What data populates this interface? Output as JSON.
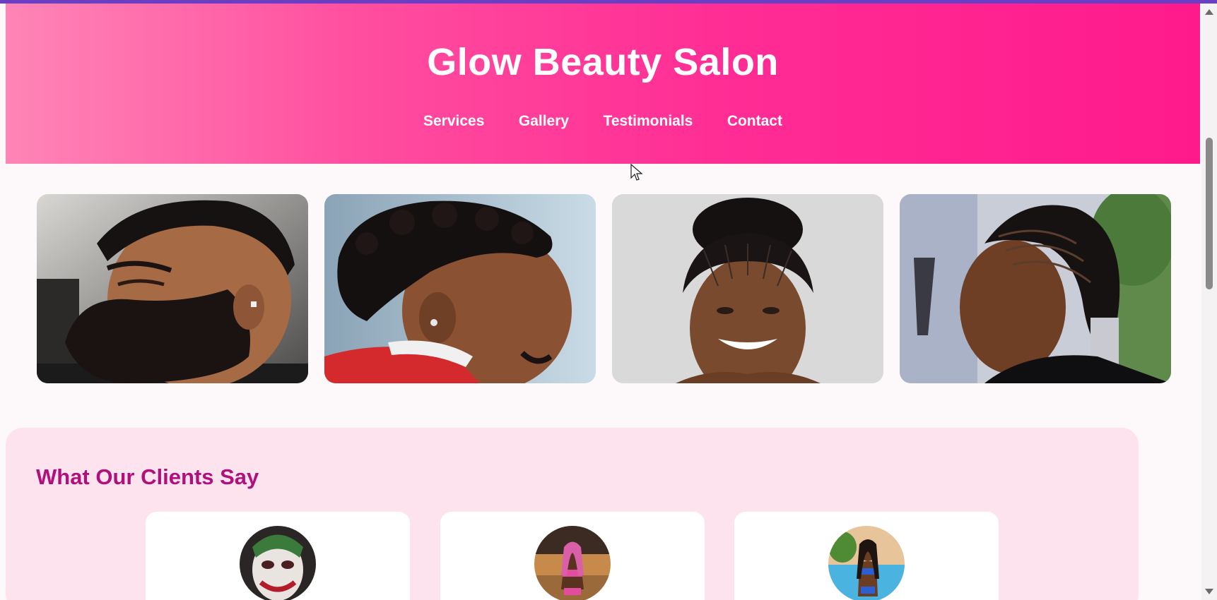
{
  "header": {
    "title": "Glow Beauty Salon",
    "nav": [
      "Services",
      "Gallery",
      "Testimonials",
      "Contact"
    ]
  },
  "gallery": {
    "images": [
      "man-with-skin-fade-and-beard",
      "man-with-curly-top-taper-fade",
      "woman-with-braided-updo",
      "woman-with-cornrow-braids"
    ]
  },
  "testimonials": {
    "title": "What Our Clients Say",
    "avatars": [
      "client-avatar-joker",
      "client-avatar-poolside",
      "client-avatar-beach"
    ]
  },
  "colors": {
    "header_gradient_start": "#ff85b6",
    "header_gradient_end": "#ff1a8c",
    "testimonials_title": "#b0107c",
    "testimonials_bg": "#fde3ee",
    "page_bg": "#fdf8f9"
  }
}
